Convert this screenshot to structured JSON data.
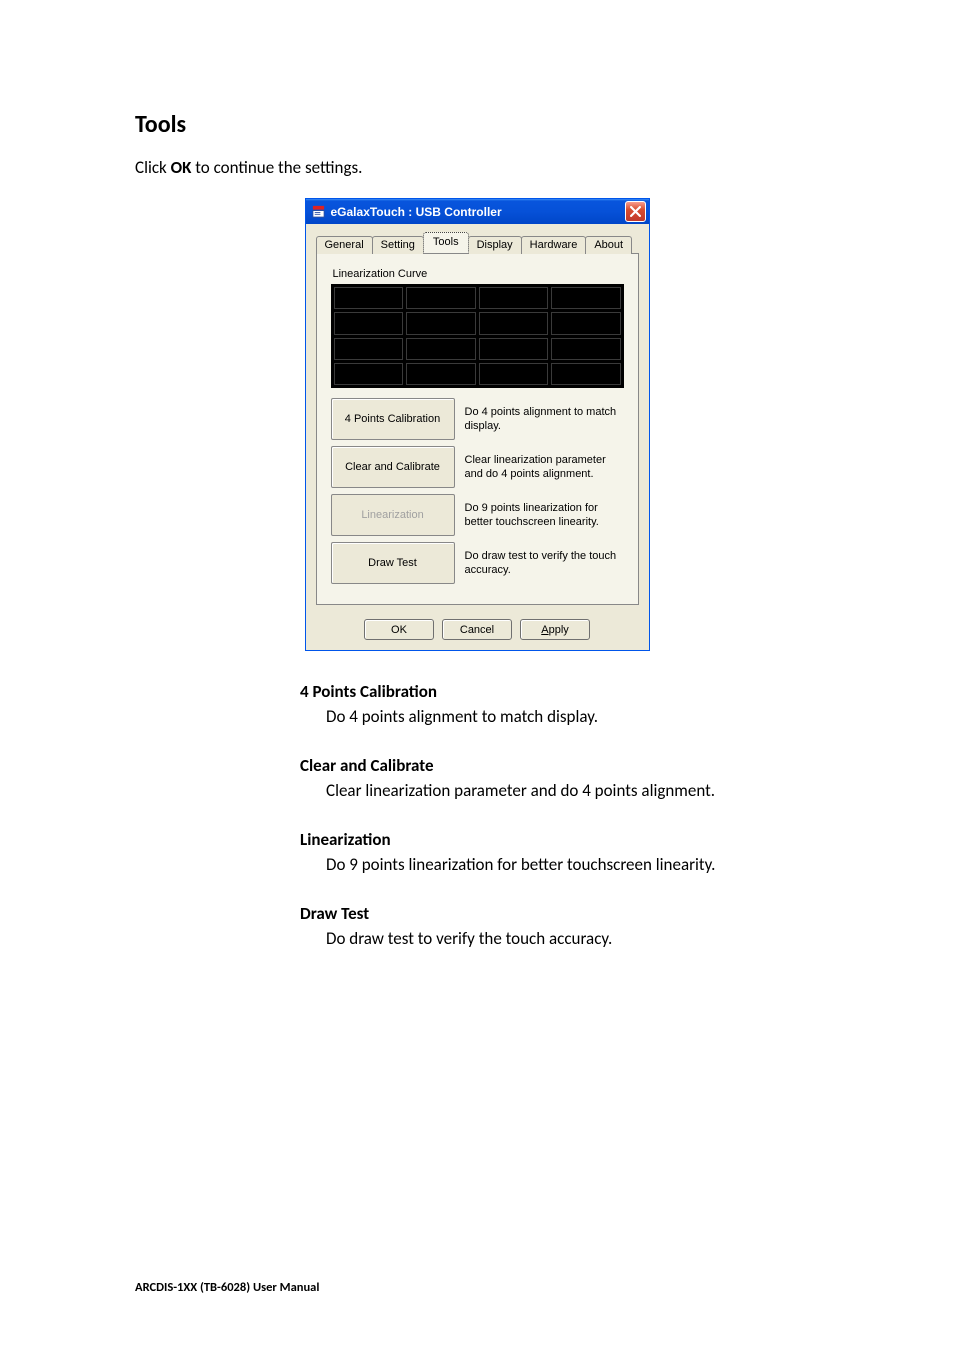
{
  "doc": {
    "section_title": "Tools",
    "intro_pre": "Click ",
    "intro_bold": "OK",
    "intro_post": " to continue the settings.",
    "footer": "ARCDIS-1XX (TB-6028) User Manual"
  },
  "dialog": {
    "title": "eGalaxTouch : USB Controller",
    "tabs": {
      "general": "General",
      "setting": "Setting",
      "tools": "Tools",
      "display": "Display",
      "hardware": "Hardware",
      "about": "About"
    },
    "group_label": "Linearization Curve",
    "rows": {
      "r1_btn": "4 Points Calibration",
      "r1_desc": "Do 4 points alignment to match display.",
      "r2_btn": "Clear and Calibrate",
      "r2_desc": "Clear linearization parameter and do 4 points alignment.",
      "r3_btn": "Linearization",
      "r3_desc": "Do 9 points linearization for better touchscreen linearity.",
      "r4_btn": "Draw Test",
      "r4_desc": "Do draw test to verify the touch accuracy."
    },
    "buttons": {
      "ok": "OK",
      "cancel": "Cancel",
      "apply_u": "A",
      "apply_rest": "pply"
    }
  },
  "explain": {
    "t1": "4 Points Calibration",
    "d1": "Do 4 points alignment to match display.",
    "t2": "Clear and Calibrate",
    "d2": "Clear linearization parameter and do 4 points alignment.",
    "t3": "Linearization",
    "d3": "Do 9 points linearization for better touchscreen linearity.",
    "t4": "Draw Test",
    "d4": "Do draw test to verify the touch accuracy."
  }
}
